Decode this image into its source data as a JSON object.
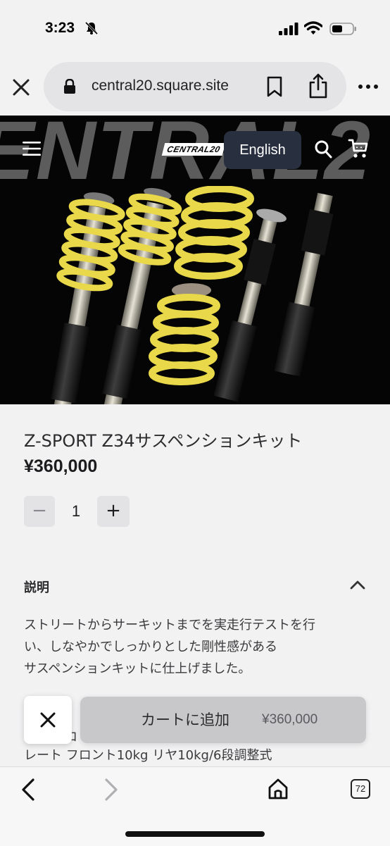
{
  "status": {
    "time": "3:23"
  },
  "browser": {
    "url": "central20.square.site",
    "tab_count": "72"
  },
  "site": {
    "banner_word": "ENTRAL2",
    "logo_text": "CENTRAL20",
    "language_button": "English"
  },
  "product": {
    "title": "Z-SPORT Z34サスペンションキット",
    "price": "¥360,000",
    "quantity": "1",
    "qty_minus": "−",
    "qty_plus": "+"
  },
  "description": {
    "heading": "説明",
    "lines": [
      "ストリートからサーキットまでを実走行テストを行",
      "い、しなやかでしっかりとした剛性感がある",
      "サスペンションキットに仕上げました。"
    ],
    "partial_line_1": "、",
    "partial_line_2": "ロ",
    "last_visible_line": "レート フロント10kg リヤ10kg/6段調整式"
  },
  "cart_bar": {
    "add_label": "カートに追加",
    "add_price": "¥360,000"
  },
  "colors": {
    "spring_yellow": "#e8d84a",
    "lang_button_bg": "#283040",
    "hero_bg": "#050505"
  }
}
